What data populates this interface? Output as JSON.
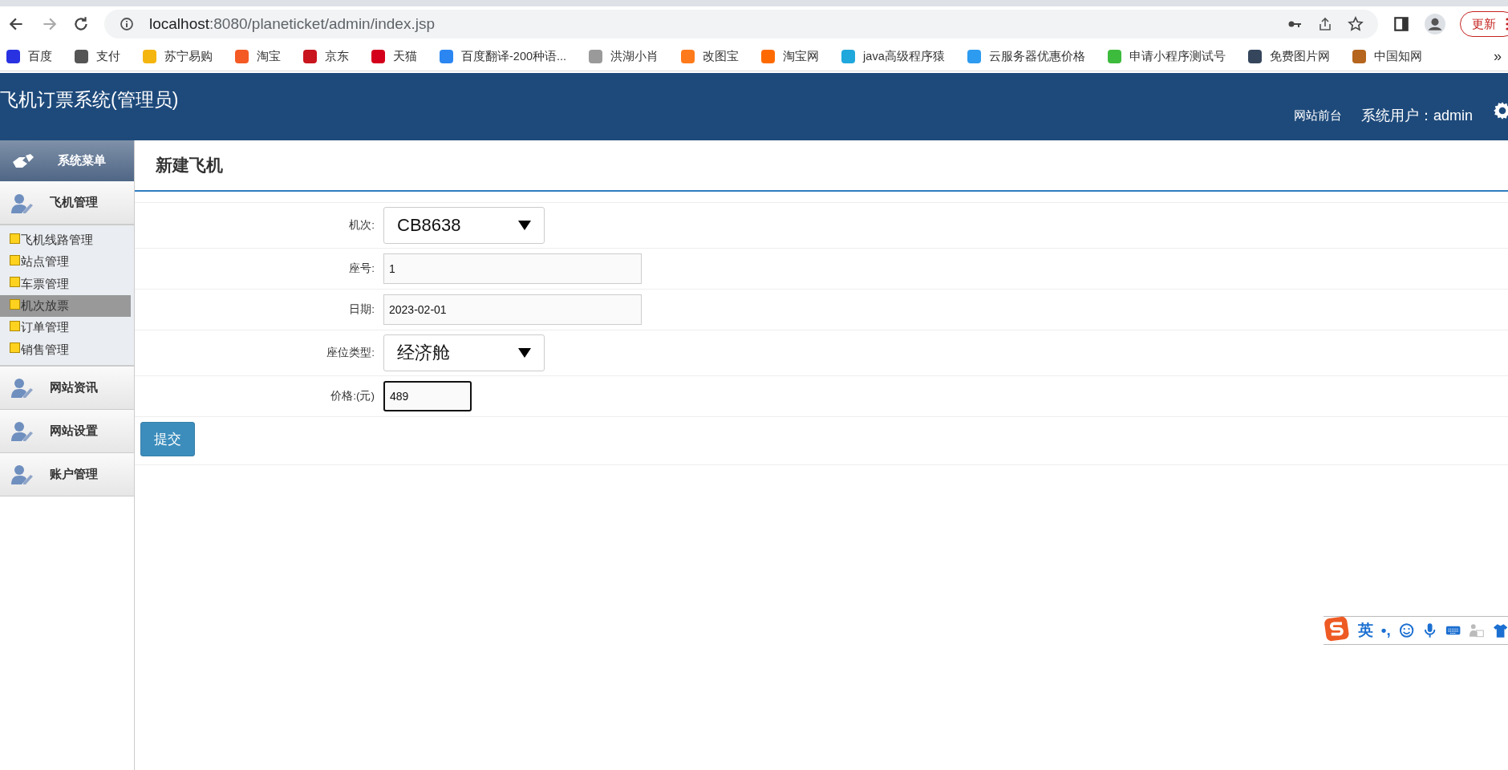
{
  "browser": {
    "url_host": "localhost",
    "url_path": ":8080/planeticket/admin/index.jsp",
    "update_button": "更新",
    "bookmarks": [
      {
        "label": "百度",
        "color": "#2932e1"
      },
      {
        "label": "支付",
        "color": "#555555"
      },
      {
        "label": "苏宁易购",
        "color": "#f5b50f"
      },
      {
        "label": "淘宝",
        "color": "#f45a24"
      },
      {
        "label": "京东",
        "color": "#c9151e"
      },
      {
        "label": "天猫",
        "color": "#d4001b"
      },
      {
        "label": "百度翻译-200种语...",
        "color": "#2b86f2"
      },
      {
        "label": "洪湖小肖",
        "color": "#9a9a9a"
      },
      {
        "label": "改图宝",
        "color": "#ff7a1a"
      },
      {
        "label": "淘宝网",
        "color": "#ff6a00"
      },
      {
        "label": "java高级程序猿",
        "color": "#20a7dc"
      },
      {
        "label": "云服务器优惠价格",
        "color": "#2d9bf0"
      },
      {
        "label": "申请小程序测试号",
        "color": "#3dbb3d"
      },
      {
        "label": "免费图片网",
        "color": "#35465c"
      },
      {
        "label": "中国知网",
        "color": "#b5651d"
      }
    ],
    "more": "»"
  },
  "header": {
    "title": "飞机订票系统(管理员)",
    "front_link": "网站前台",
    "user": "系统用户：admin"
  },
  "sidebar": {
    "heading": "系统菜单",
    "groups": [
      {
        "label": "飞机管理",
        "expanded": true,
        "items": [
          {
            "label": "飞机线路管理",
            "selected": false
          },
          {
            "label": "站点管理",
            "selected": false
          },
          {
            "label": "车票管理",
            "selected": false
          },
          {
            "label": "机次放票",
            "selected": true
          },
          {
            "label": "订单管理",
            "selected": false
          },
          {
            "label": "销售管理",
            "selected": false
          }
        ]
      },
      {
        "label": "网站资讯",
        "expanded": false
      },
      {
        "label": "网站设置",
        "expanded": false
      },
      {
        "label": "账户管理",
        "expanded": false
      }
    ]
  },
  "form": {
    "title": "新建飞机",
    "fields": [
      {
        "label": "机次:",
        "kind": "select",
        "value": "CB8638",
        "focused": false
      },
      {
        "label": "座号:",
        "kind": "text",
        "value": "1",
        "focused": false
      },
      {
        "label": "日期:",
        "kind": "text",
        "value": "2023-02-01",
        "focused": false
      },
      {
        "label": "座位类型:",
        "kind": "select",
        "value": "经济舱",
        "focused": false
      },
      {
        "label": "价格:(元)",
        "kind": "short",
        "value": "489",
        "focused": true
      }
    ],
    "submit": "提交"
  },
  "ime": {
    "mode": "英",
    "punct": "•,"
  }
}
